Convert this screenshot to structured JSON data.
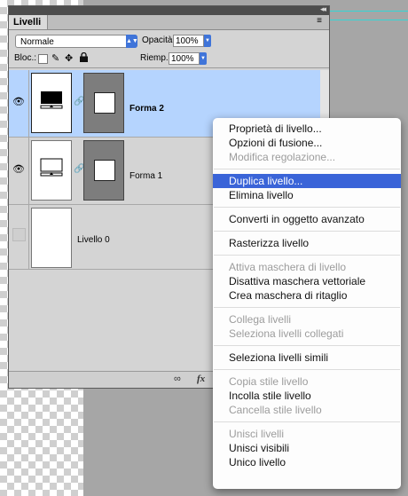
{
  "panel": {
    "tab_label": "Livelli",
    "collapse_glyph": "◂◂",
    "menu_glyph": "≡",
    "blend_mode": "Normale",
    "opacity_label": "Opacità:",
    "opacity_value": "100%",
    "lock_label": "Bloc.:",
    "fill_label": "Riemp.:",
    "fill_value": "100%"
  },
  "layers": [
    {
      "name": "Forma 2",
      "visible": true,
      "selected": true
    },
    {
      "name": "Forma 1",
      "visible": true,
      "selected": false
    },
    {
      "name": "Livello 0",
      "visible": false,
      "selected": false
    }
  ],
  "footer": {
    "link_icon": "link-icon",
    "fx_label": "fx"
  },
  "context_menu": {
    "groups": [
      [
        {
          "label": "Proprietà di livello...",
          "enabled": true
        },
        {
          "label": "Opzioni di fusione...",
          "enabled": true
        },
        {
          "label": "Modifica regolazione...",
          "enabled": false
        }
      ],
      [
        {
          "label": "Duplica livello...",
          "enabled": true,
          "highlighted": true
        },
        {
          "label": "Elimina livello",
          "enabled": true
        }
      ],
      [
        {
          "label": "Converti in oggetto avanzato",
          "enabled": true
        }
      ],
      [
        {
          "label": "Rasterizza livello",
          "enabled": true
        }
      ],
      [
        {
          "label": "Attiva maschera di livello",
          "enabled": false
        },
        {
          "label": "Disattiva maschera vettoriale",
          "enabled": true
        },
        {
          "label": "Crea maschera di ritaglio",
          "enabled": true
        }
      ],
      [
        {
          "label": "Collega livelli",
          "enabled": false
        },
        {
          "label": "Seleziona livelli collegati",
          "enabled": false
        }
      ],
      [
        {
          "label": "Seleziona livelli simili",
          "enabled": true
        }
      ],
      [
        {
          "label": "Copia stile livello",
          "enabled": false
        },
        {
          "label": "Incolla stile livello",
          "enabled": true
        },
        {
          "label": "Cancella stile livello",
          "enabled": false
        }
      ],
      [
        {
          "label": "Unisci livelli",
          "enabled": false
        },
        {
          "label": "Unisci visibili",
          "enabled": true
        },
        {
          "label": "Unico livello",
          "enabled": true
        }
      ]
    ]
  },
  "colors": {
    "selected_layer": "#b5d4fe",
    "menu_highlight": "#3a64d8",
    "accent_blue": "#3f74d9"
  }
}
